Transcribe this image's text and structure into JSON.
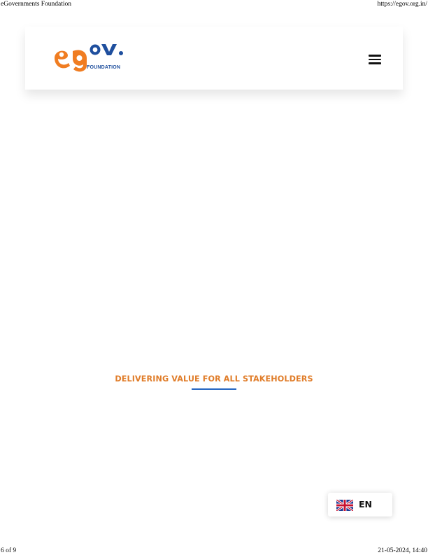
{
  "print_header": {
    "site_name": "eGovernments Foundation",
    "url": "https://egov.org.in/"
  },
  "print_footer": {
    "page": "6 of 9",
    "datetime": "21-05-2024, 14:40"
  },
  "header": {
    "logo": {
      "text": "egov.",
      "subtext": "FOUNDATION",
      "colors": {
        "orange": "#f07d22",
        "blue": "#1f4f9e"
      }
    },
    "menu_icon": "hamburger-icon"
  },
  "section": {
    "title": "DELIVERING VALUE FOR ALL STAKEHOLDERS",
    "title_color": "#e07d2a",
    "rule_color": "#2466c2"
  },
  "language_switcher": {
    "label": "EN",
    "flag_icon": "uk-flag-icon"
  }
}
